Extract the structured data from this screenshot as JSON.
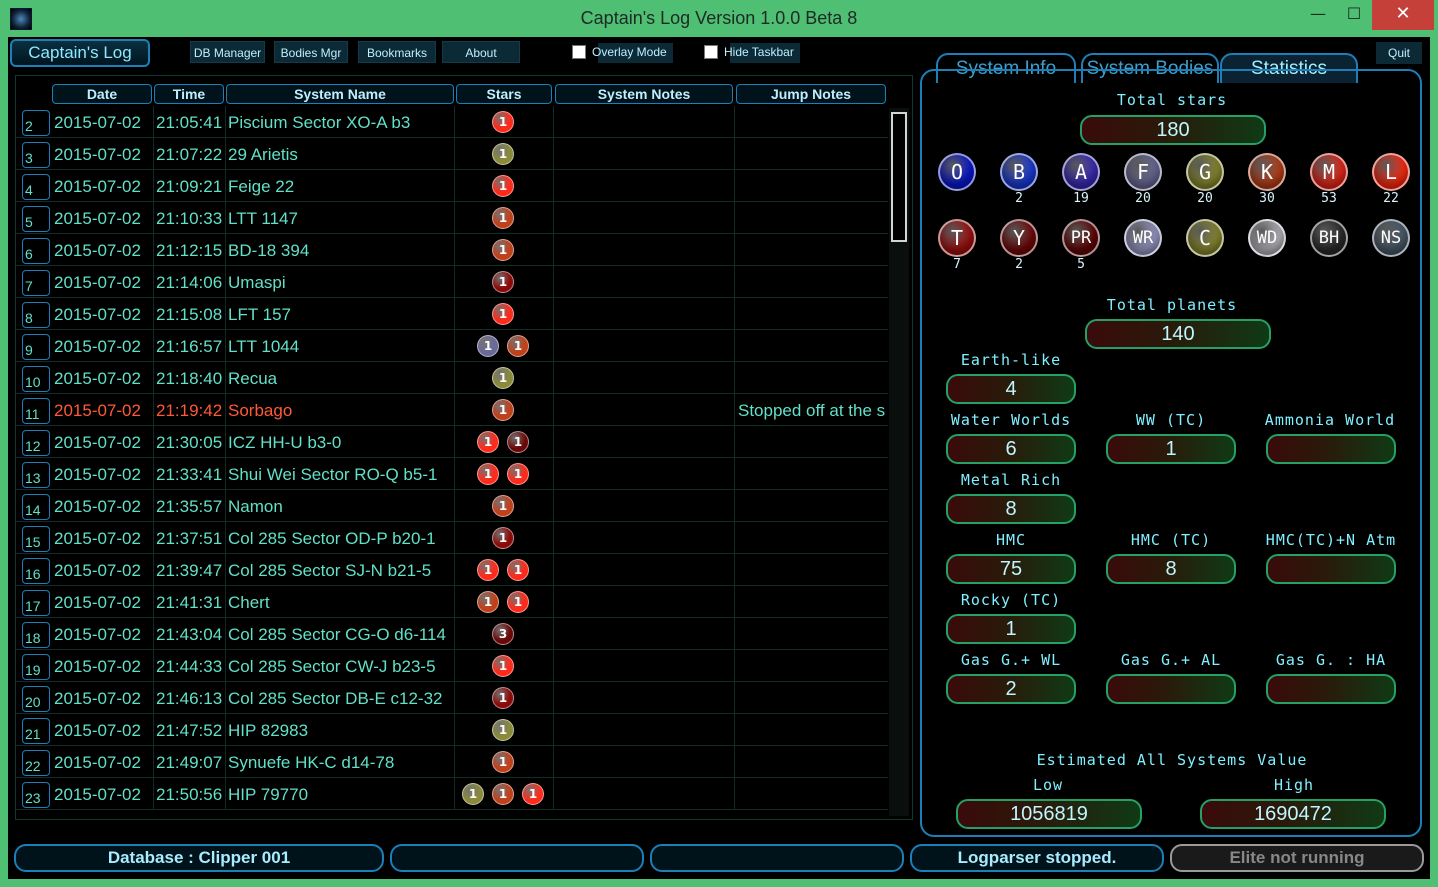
{
  "window": {
    "title": "Captain's Log Version 1.0.0 Beta 8",
    "minimize": "—",
    "maximize": "☐",
    "close": "✕"
  },
  "toolbar": {
    "main_tab": "Captain's Log",
    "buttons": [
      "DB Manager",
      "Bodies Mgr",
      "Bookmarks",
      "About"
    ],
    "overlay_mode": "Overlay Mode",
    "hide_taskbar": "Hide Taskbar",
    "quit": "Quit"
  },
  "log": {
    "columns": [
      "Date",
      "Time",
      "System Name",
      "Stars",
      "System Notes",
      "Jump Notes"
    ],
    "rows": [
      {
        "n": "2",
        "date": "2015-07-02",
        "time": "21:05:41",
        "name": "Piscium Sector XO-A b3",
        "stars": [
          {
            "c": "#ff2a1a",
            "v": "1"
          }
        ],
        "jump": ""
      },
      {
        "n": "3",
        "date": "2015-07-02",
        "time": "21:07:22",
        "name": "29 Arietis",
        "stars": [
          {
            "c": "#8a8a3a",
            "v": "1"
          }
        ],
        "jump": ""
      },
      {
        "n": "4",
        "date": "2015-07-02",
        "time": "21:09:21",
        "name": "Feige 22",
        "stars": [
          {
            "c": "#ff2a1a",
            "v": "1"
          }
        ],
        "jump": ""
      },
      {
        "n": "5",
        "date": "2015-07-02",
        "time": "21:10:33",
        "name": "LTT 1147",
        "stars": [
          {
            "c": "#c0401a",
            "v": "1"
          }
        ],
        "jump": ""
      },
      {
        "n": "6",
        "date": "2015-07-02",
        "time": "21:12:15",
        "name": "BD-18 394",
        "stars": [
          {
            "c": "#c0401a",
            "v": "1"
          }
        ],
        "jump": ""
      },
      {
        "n": "7",
        "date": "2015-07-02",
        "time": "21:14:06",
        "name": "Umaspi",
        "stars": [
          {
            "c": "#8a0a0a",
            "v": "1"
          }
        ],
        "jump": ""
      },
      {
        "n": "8",
        "date": "2015-07-02",
        "time": "21:15:08",
        "name": "LFT 157",
        "stars": [
          {
            "c": "#ff2a1a",
            "v": "1"
          }
        ],
        "jump": ""
      },
      {
        "n": "9",
        "date": "2015-07-02",
        "time": "21:16:57",
        "name": "LTT 1044",
        "stars": [
          {
            "c": "#6a6a9a",
            "v": "1"
          },
          {
            "c": "#c0401a",
            "v": "1"
          }
        ],
        "jump": ""
      },
      {
        "n": "10",
        "date": "2015-07-02",
        "time": "21:18:40",
        "name": "Recua",
        "stars": [
          {
            "c": "#8a8a3a",
            "v": "1"
          }
        ],
        "jump": ""
      },
      {
        "n": "11",
        "date": "2015-07-02",
        "time": "21:19:42",
        "name": "Sorbago",
        "stars": [
          {
            "c": "#c0401a",
            "v": "1"
          }
        ],
        "jump": "Stopped off at the s",
        "highlight": true
      },
      {
        "n": "12",
        "date": "2015-07-02",
        "time": "21:30:05",
        "name": "ICZ HH-U b3-0",
        "stars": [
          {
            "c": "#ff2a1a",
            "v": "1"
          },
          {
            "c": "#6a0808",
            "v": "1"
          }
        ],
        "jump": ""
      },
      {
        "n": "13",
        "date": "2015-07-02",
        "time": "21:33:41",
        "name": "Shui Wei Sector RO-Q b5-1",
        "stars": [
          {
            "c": "#ff2a1a",
            "v": "1"
          },
          {
            "c": "#ff2a1a",
            "v": "1"
          }
        ],
        "jump": ""
      },
      {
        "n": "14",
        "date": "2015-07-02",
        "time": "21:35:57",
        "name": "Namon",
        "stars": [
          {
            "c": "#c0401a",
            "v": "1"
          }
        ],
        "jump": ""
      },
      {
        "n": "15",
        "date": "2015-07-02",
        "time": "21:37:51",
        "name": "Col 285 Sector OD-P b20-1",
        "stars": [
          {
            "c": "#8a0a0a",
            "v": "1"
          }
        ],
        "jump": ""
      },
      {
        "n": "16",
        "date": "2015-07-02",
        "time": "21:39:47",
        "name": "Col 285 Sector SJ-N b21-5",
        "stars": [
          {
            "c": "#ff2a1a",
            "v": "1"
          },
          {
            "c": "#ff2a1a",
            "v": "1"
          }
        ],
        "jump": ""
      },
      {
        "n": "17",
        "date": "2015-07-02",
        "time": "21:41:31",
        "name": "Chert",
        "stars": [
          {
            "c": "#c0401a",
            "v": "1"
          },
          {
            "c": "#ff2a1a",
            "v": "1"
          }
        ],
        "jump": ""
      },
      {
        "n": "18",
        "date": "2015-07-02",
        "time": "21:43:04",
        "name": "Col 285 Sector CG-O d6-114",
        "stars": [
          {
            "c": "#6a0808",
            "v": "3"
          }
        ],
        "jump": ""
      },
      {
        "n": "19",
        "date": "2015-07-02",
        "time": "21:44:33",
        "name": "Col 285 Sector CW-J b23-5",
        "stars": [
          {
            "c": "#ff2a1a",
            "v": "1"
          }
        ],
        "jump": ""
      },
      {
        "n": "20",
        "date": "2015-07-02",
        "time": "21:46:13",
        "name": "Col 285 Sector DB-E c12-32",
        "stars": [
          {
            "c": "#8a0a0a",
            "v": "1"
          }
        ],
        "jump": ""
      },
      {
        "n": "21",
        "date": "2015-07-02",
        "time": "21:47:52",
        "name": "HIP 82983",
        "stars": [
          {
            "c": "#8a8a3a",
            "v": "1"
          }
        ],
        "jump": ""
      },
      {
        "n": "22",
        "date": "2015-07-02",
        "time": "21:49:07",
        "name": "Synuefe HK-C d14-78",
        "stars": [
          {
            "c": "#c0401a",
            "v": "1"
          }
        ],
        "jump": ""
      },
      {
        "n": "23",
        "date": "2015-07-02",
        "time": "21:50:56",
        "name": "HIP 79770",
        "stars": [
          {
            "c": "#8a8a3a",
            "v": "1"
          },
          {
            "c": "#c0401a",
            "v": "1"
          },
          {
            "c": "#ff2a1a",
            "v": "1"
          }
        ],
        "jump": ""
      }
    ]
  },
  "right_tabs": [
    "System Info",
    "System Bodies",
    "Statistics"
  ],
  "stats": {
    "total_stars_label": "Total stars",
    "total_stars": "180",
    "star_classes": [
      {
        "label": "O",
        "count": "",
        "color": "#0a18d0"
      },
      {
        "label": "B",
        "count": "2",
        "color": "#1a3ad8"
      },
      {
        "label": "A",
        "count": "19",
        "color": "#3a2ab8"
      },
      {
        "label": "F",
        "count": "20",
        "color": "#6a6a98"
      },
      {
        "label": "G",
        "count": "20",
        "color": "#8a8a30"
      },
      {
        "label": "K",
        "count": "30",
        "color": "#b8401a"
      },
      {
        "label": "M",
        "count": "53",
        "color": "#e8281a"
      },
      {
        "label": "L",
        "count": "22",
        "color": "#ff2a10"
      },
      {
        "label": "T",
        "count": "7",
        "color": "#a01010"
      },
      {
        "label": "Y",
        "count": "2",
        "color": "#700808"
      },
      {
        "label": "PR",
        "count": "5",
        "color": "#600606"
      },
      {
        "label": "WR",
        "count": "",
        "color": "#9a9ac8"
      },
      {
        "label": "C",
        "count": "",
        "color": "#8a8a30"
      },
      {
        "label": "WD",
        "count": "",
        "color": "#b8b8c0"
      },
      {
        "label": "BH",
        "count": "",
        "color": "#2a2a2a"
      },
      {
        "label": "NS",
        "count": "",
        "color": "#4a5a6a"
      }
    ],
    "total_planets_label": "Total planets",
    "total_planets": "140",
    "earth_like_label": "Earth-like",
    "earth_like": "4",
    "water_worlds_label": "Water Worlds",
    "water_worlds": "6",
    "ww_tc_label": "WW (TC)",
    "ww_tc": "1",
    "ammonia_label": "Ammonia World",
    "ammonia": "",
    "metal_rich_label": "Metal Rich",
    "metal_rich": "8",
    "hmc_label": "HMC",
    "hmc": "75",
    "hmc_tc_label": "HMC (TC)",
    "hmc_tc": "8",
    "hmc_tc_n_label": "HMC(TC)+N Atm",
    "hmc_tc_n": "",
    "rocky_tc_label": "Rocky (TC)",
    "rocky_tc": "1",
    "gas_wl_label": "Gas G.+ WL",
    "gas_wl": "2",
    "gas_al_label": "Gas G.+ AL",
    "gas_al": "",
    "gas_ha_label": "Gas G. : HA",
    "gas_ha": "",
    "est_label": "Estimated All Systems Value",
    "low_label": "Low",
    "low": "1056819",
    "high_label": "High",
    "high": "1690472"
  },
  "status": {
    "database": "Database : Clipper 001",
    "box2": "",
    "box3": "",
    "logparser": "Logparser stopped.",
    "elite": "Elite not running"
  }
}
